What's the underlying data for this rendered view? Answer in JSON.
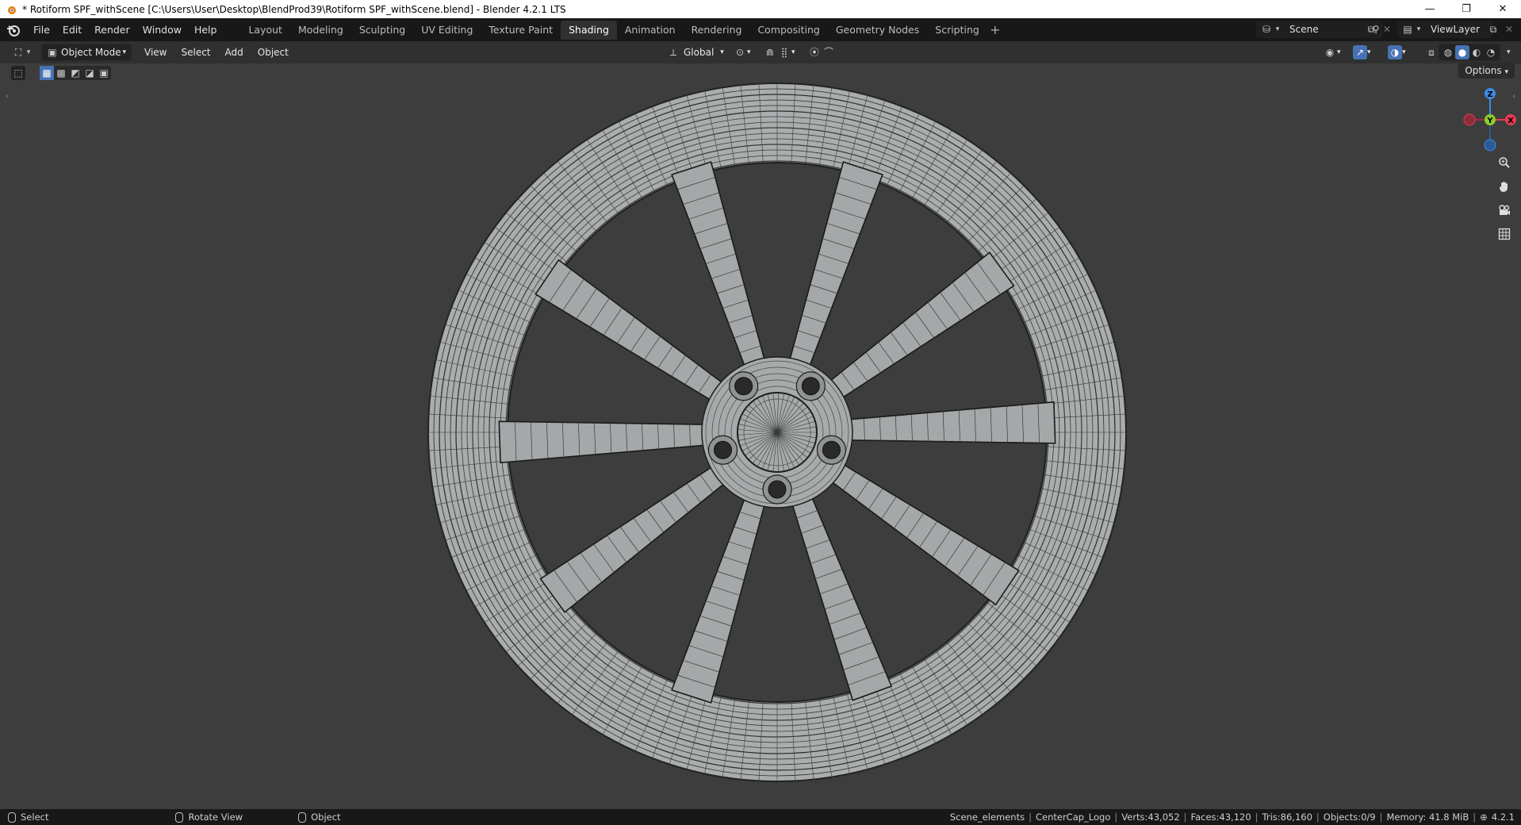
{
  "window": {
    "title": "* Rotiform SPF_withScene [C:\\Users\\User\\Desktop\\BlendProd39\\Rotiform SPF_withScene.blend] - Blender 4.2.1 LTS",
    "minimize": "—",
    "maximize": "❐",
    "close": "✕"
  },
  "menu": [
    "File",
    "Edit",
    "Render",
    "Window",
    "Help"
  ],
  "workspaces": {
    "tabs": [
      "Layout",
      "Modeling",
      "Sculpting",
      "UV Editing",
      "Texture Paint",
      "Shading",
      "Animation",
      "Rendering",
      "Compositing",
      "Geometry Nodes",
      "Scripting"
    ],
    "active": "Shading",
    "add": "+"
  },
  "scene": {
    "label": "Scene",
    "viewlayer": "ViewLayer"
  },
  "viewport_header": {
    "mode": "Object Mode",
    "menus": [
      "View",
      "Select",
      "Add",
      "Object"
    ],
    "orientation": "Global",
    "options": "Options"
  },
  "gizmo": {
    "z": "Z",
    "y": "Y",
    "x": "X"
  },
  "statusbar": {
    "select": "Select",
    "rotate": "Rotate View",
    "object": "Object",
    "collection": "Scene_elements",
    "active": "CenterCap_Logo",
    "verts": "Verts:43,052",
    "faces": "Faces:43,120",
    "tris": "Tris:86,160",
    "objects": "Objects:0/9",
    "memory": "Memory: 41.8 MiB",
    "version": "4.2.1"
  },
  "colors": {
    "active_tab_bg": "#303030",
    "topbar_bg": "#181818",
    "viewport_bg": "#3d3d3d",
    "gizmo_x": "#e63b55",
    "gizmo_y": "#8ccd2a",
    "gizmo_z": "#3d8ce6",
    "accent": "#4772b3"
  }
}
